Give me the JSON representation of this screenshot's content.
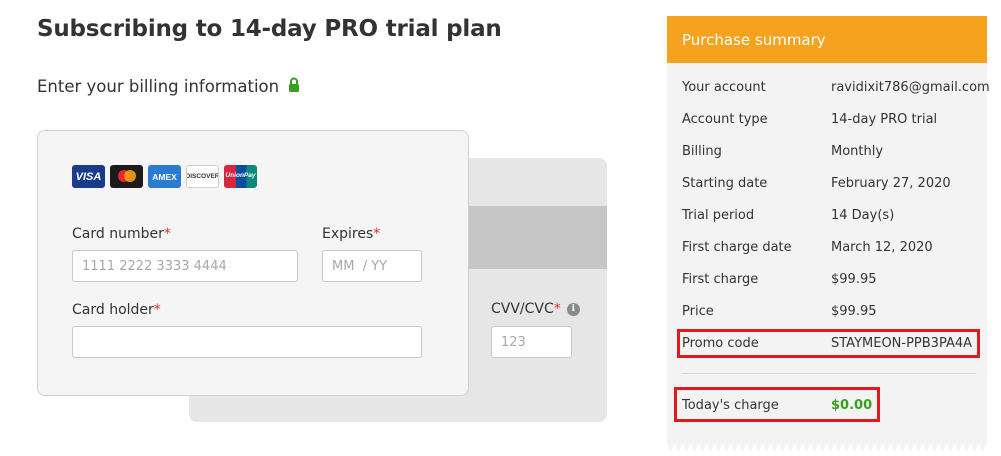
{
  "page": {
    "title": "Subscribing to 14-day PRO trial plan"
  },
  "billing": {
    "heading": "Enter your billing information",
    "card_logos": [
      {
        "name": "visa-logo",
        "label": "VISA"
      },
      {
        "name": "mastercard-logo",
        "label": ""
      },
      {
        "name": "amex-logo",
        "label": "AMEX"
      },
      {
        "name": "discover-logo",
        "label": "DISCOVER"
      },
      {
        "name": "unionpay-logo",
        "label": "UnionPay"
      }
    ],
    "card_number": {
      "label": "Card number",
      "required": "*",
      "placeholder": "1111 2222 3333 4444"
    },
    "expires": {
      "label": "Expires",
      "required": "*",
      "placeholder": "MM  / YY"
    },
    "card_holder": {
      "label": "Card holder",
      "required": "*",
      "placeholder": ""
    },
    "cvv": {
      "label": "CVV/CVC",
      "required": "*",
      "placeholder": "123",
      "info_icon": "info-icon"
    }
  },
  "summary": {
    "header": "Purchase summary",
    "rows": [
      {
        "key": "Your account",
        "value": "ravidixit786@gmail.com"
      },
      {
        "key": "Account type",
        "value": "14-day PRO trial"
      },
      {
        "key": "Billing",
        "value": "Monthly"
      },
      {
        "key": "Starting date",
        "value": "February 27, 2020"
      },
      {
        "key": "Trial period",
        "value": "14 Day(s)"
      },
      {
        "key": "First charge date",
        "value": "March 12, 2020"
      },
      {
        "key": "First charge",
        "value": "$99.95"
      },
      {
        "key": "Price",
        "value": "$99.95"
      },
      {
        "key": "Promo code",
        "value": "STAYMEON-PPB3PA4A"
      }
    ],
    "today_charge": {
      "key": "Today's charge",
      "value": "$0.00"
    }
  },
  "colors": {
    "accent_orange": "#f7a21f",
    "charge_green": "#3aa022",
    "required_red": "#e0312f",
    "highlight_red": "#e01b1b"
  }
}
